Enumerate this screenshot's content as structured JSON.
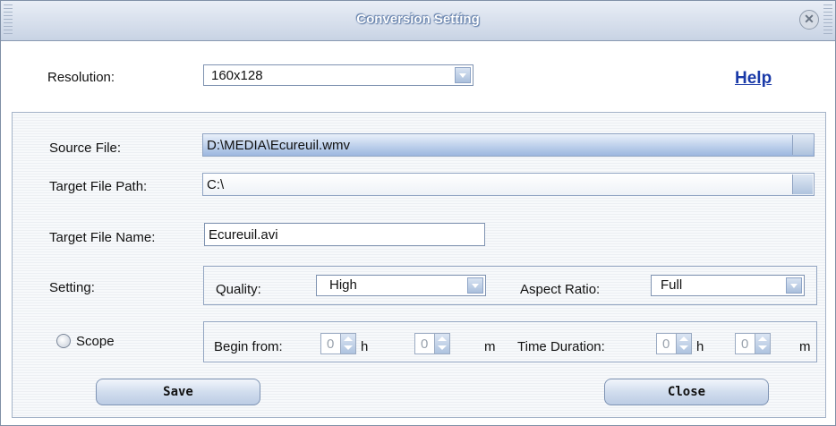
{
  "window": {
    "title": "Conversion Setting"
  },
  "resolution": {
    "label": "Resolution:",
    "value": "160x128"
  },
  "help_link": "Help",
  "source_file": {
    "label": "Source File:",
    "value": "D:\\MEDIA\\Ecureuil.wmv"
  },
  "target_file_path": {
    "label": "Target File Path:",
    "value": "C:\\"
  },
  "target_file_name": {
    "label": "Target File Name:",
    "value": "Ecureuil.avi"
  },
  "setting": {
    "label": "Setting:",
    "quality_label": "Quality:",
    "quality_value": "High",
    "aspect_label": "Aspect Ratio:",
    "aspect_value": "Full"
  },
  "scope": {
    "label": "Scope",
    "begin_label": "Begin from:",
    "begin_h": "0",
    "h_unit": "h",
    "begin_m": "0",
    "m_unit": "m",
    "duration_label": "Time Duration:",
    "duration_h": "0",
    "duration_m": "0"
  },
  "buttons": {
    "save": "Save",
    "close": "Close"
  }
}
